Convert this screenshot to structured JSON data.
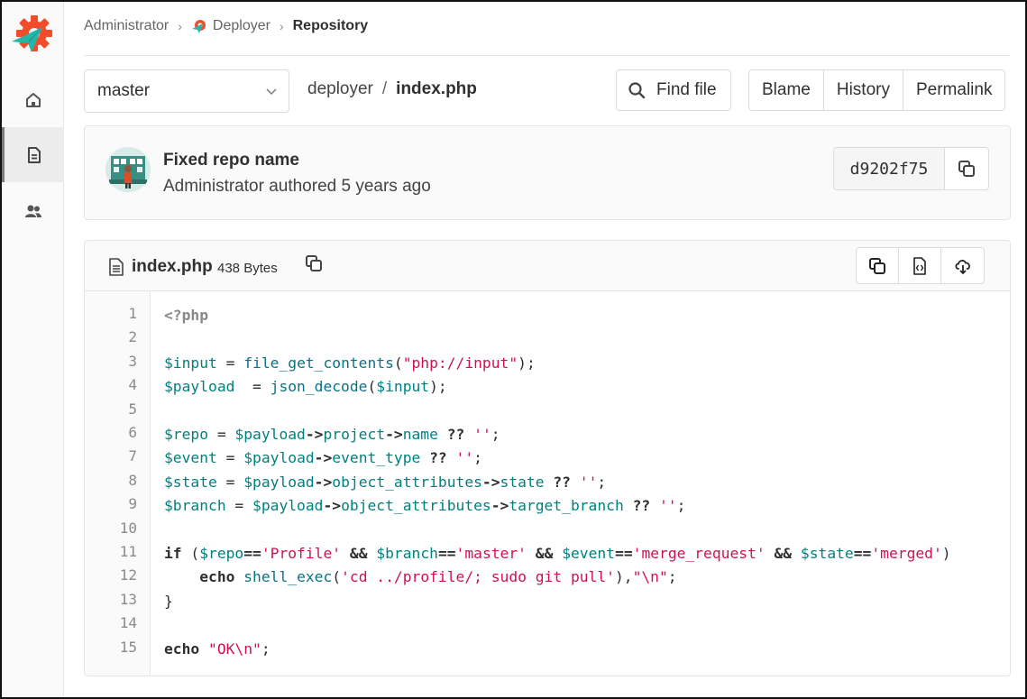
{
  "breadcrumb": {
    "items": [
      "Administrator",
      "Deployer",
      "Repository"
    ]
  },
  "toolbar": {
    "branch": "master",
    "project": "deployer",
    "separator": "/",
    "file": "index.php",
    "find_file": "Find file",
    "blame": "Blame",
    "history": "History",
    "permalink": "Permalink"
  },
  "commit": {
    "title": "Fixed repo name",
    "meta": "Administrator authored 5 years ago",
    "sha": "d9202f75"
  },
  "file": {
    "name": "index.php",
    "size": "438 Bytes"
  },
  "code": {
    "lines": [
      [
        [
          "t-tag",
          "<?php"
        ]
      ],
      [],
      [
        [
          "t-var",
          "$input"
        ],
        [
          "t-pl",
          " = "
        ],
        [
          "t-fn",
          "file_get_contents"
        ],
        [
          "t-pl",
          "("
        ],
        [
          "t-str",
          "\"php://input\""
        ],
        [
          "t-pl",
          ");"
        ]
      ],
      [
        [
          "t-var",
          "$payload"
        ],
        [
          "t-pl",
          "  = "
        ],
        [
          "t-fn",
          "json_decode"
        ],
        [
          "t-pl",
          "("
        ],
        [
          "t-var",
          "$input"
        ],
        [
          "t-pl",
          ");"
        ]
      ],
      [],
      [
        [
          "t-var",
          "$repo"
        ],
        [
          "t-pl",
          " = "
        ],
        [
          "t-var",
          "$payload"
        ],
        [
          "t-op",
          "->"
        ],
        [
          "t-var",
          "project"
        ],
        [
          "t-op",
          "->"
        ],
        [
          "t-var",
          "name"
        ],
        [
          "t-pl",
          " "
        ],
        [
          "t-op",
          "??"
        ],
        [
          "t-pl",
          " "
        ],
        [
          "t-str",
          "''"
        ],
        [
          "t-pl",
          ";"
        ]
      ],
      [
        [
          "t-var",
          "$event"
        ],
        [
          "t-pl",
          " = "
        ],
        [
          "t-var",
          "$payload"
        ],
        [
          "t-op",
          "->"
        ],
        [
          "t-var",
          "event_type"
        ],
        [
          "t-pl",
          " "
        ],
        [
          "t-op",
          "??"
        ],
        [
          "t-pl",
          " "
        ],
        [
          "t-str",
          "''"
        ],
        [
          "t-pl",
          ";"
        ]
      ],
      [
        [
          "t-var",
          "$state"
        ],
        [
          "t-pl",
          " = "
        ],
        [
          "t-var",
          "$payload"
        ],
        [
          "t-op",
          "->"
        ],
        [
          "t-var",
          "object_attributes"
        ],
        [
          "t-op",
          "->"
        ],
        [
          "t-var",
          "state"
        ],
        [
          "t-pl",
          " "
        ],
        [
          "t-op",
          "??"
        ],
        [
          "t-pl",
          " "
        ],
        [
          "t-str",
          "''"
        ],
        [
          "t-pl",
          ";"
        ]
      ],
      [
        [
          "t-var",
          "$branch"
        ],
        [
          "t-pl",
          " = "
        ],
        [
          "t-var",
          "$payload"
        ],
        [
          "t-op",
          "->"
        ],
        [
          "t-var",
          "object_attributes"
        ],
        [
          "t-op",
          "->"
        ],
        [
          "t-var",
          "target_branch"
        ],
        [
          "t-pl",
          " "
        ],
        [
          "t-op",
          "??"
        ],
        [
          "t-pl",
          " "
        ],
        [
          "t-str",
          "''"
        ],
        [
          "t-pl",
          ";"
        ]
      ],
      [],
      [
        [
          "t-kw",
          "if"
        ],
        [
          "t-pl",
          " ("
        ],
        [
          "t-var",
          "$repo"
        ],
        [
          "t-op",
          "=="
        ],
        [
          "t-str",
          "'Profile'"
        ],
        [
          "t-pl",
          " "
        ],
        [
          "t-op",
          "&&"
        ],
        [
          "t-pl",
          " "
        ],
        [
          "t-var",
          "$branch"
        ],
        [
          "t-op",
          "=="
        ],
        [
          "t-str",
          "'master'"
        ],
        [
          "t-pl",
          " "
        ],
        [
          "t-op",
          "&&"
        ],
        [
          "t-pl",
          " "
        ],
        [
          "t-var",
          "$event"
        ],
        [
          "t-op",
          "=="
        ],
        [
          "t-str",
          "'merge_request'"
        ],
        [
          "t-pl",
          " "
        ],
        [
          "t-op",
          "&&"
        ],
        [
          "t-pl",
          " "
        ],
        [
          "t-var",
          "$state"
        ],
        [
          "t-op",
          "=="
        ],
        [
          "t-str",
          "'merged'"
        ],
        [
          "t-pl",
          ")"
        ]
      ],
      [
        [
          "t-pl",
          "    "
        ],
        [
          "t-kw",
          "echo"
        ],
        [
          "t-pl",
          " "
        ],
        [
          "t-fn",
          "shell_exec"
        ],
        [
          "t-pl",
          "("
        ],
        [
          "t-str",
          "'cd ../profile/; sudo git pull'"
        ],
        [
          "t-pl",
          "),"
        ],
        [
          "t-str",
          "\"\\n\""
        ],
        [
          "t-pl",
          ";"
        ]
      ],
      [
        [
          "t-pl",
          "}"
        ]
      ],
      [],
      [
        [
          "t-kw",
          "echo"
        ],
        [
          "t-pl",
          " "
        ],
        [
          "t-str",
          "\"OK\\n\""
        ],
        [
          "t-pl",
          ";"
        ]
      ]
    ]
  },
  "colors": {
    "variable": "#008080",
    "string": "#d0114f",
    "function": "#0b7285",
    "logo_orange": "#f24c2b",
    "logo_teal": "#26b5a8"
  },
  "icons": [
    "tanuki-logo",
    "home-icon",
    "document-icon",
    "users-icon",
    "search-icon",
    "chevron-down-icon",
    "copy-icon",
    "file-icon",
    "display-source-icon",
    "download-icon"
  ]
}
